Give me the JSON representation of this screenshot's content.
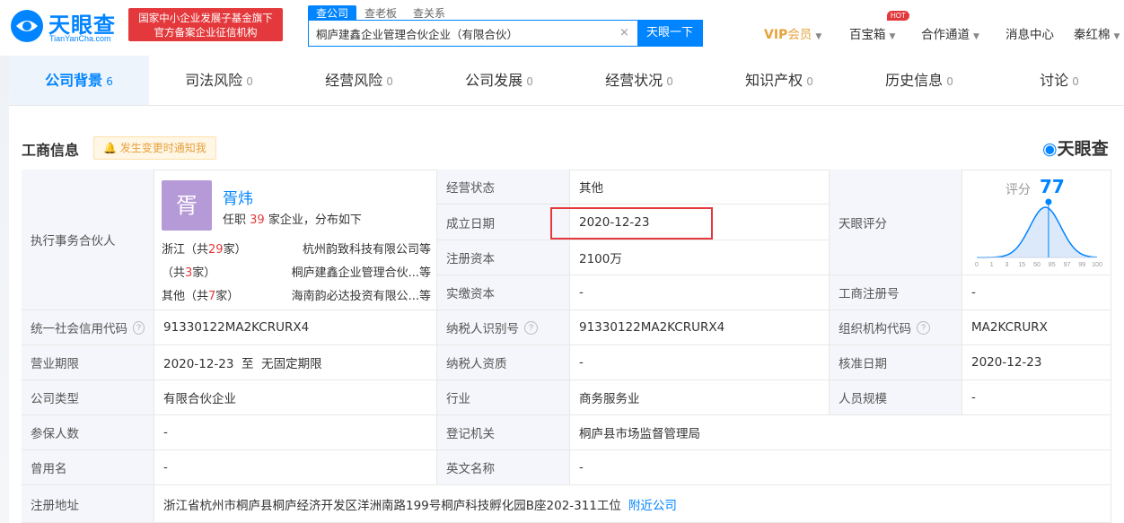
{
  "header": {
    "logo_text": "天眼查",
    "logo_sub": "TianYanCha.com",
    "gov_badge_line1": "国家中小企业发展子基金旗下",
    "gov_badge_line2": "官方备案企业征信机构",
    "search_tabs": [
      "查公司",
      "查老板",
      "查关系"
    ],
    "search_value": "桐庐建鑫企业管理合伙企业（有限合伙）",
    "search_button": "天眼一下",
    "vip": "VIP",
    "vip_label": "会员",
    "treasure": "百宝箱",
    "hot_badge": "HOT",
    "cooperation": "合作通道",
    "messages": "消息中心",
    "user": "秦红棉",
    "brand_color": "#0084ff",
    "accent_red": "#e4393c"
  },
  "tabs": [
    {
      "label": "公司背景",
      "count": "6"
    },
    {
      "label": "司法风险",
      "count": "0"
    },
    {
      "label": "经营风险",
      "count": "0"
    },
    {
      "label": "公司发展",
      "count": "0"
    },
    {
      "label": "经营状况",
      "count": "0"
    },
    {
      "label": "知识产权",
      "count": "0"
    },
    {
      "label": "历史信息",
      "count": "0"
    },
    {
      "label": "讨论",
      "count": "0"
    }
  ],
  "section": {
    "title": "工商信息",
    "notify": "发生变更时通知我",
    "brand": "天眼查"
  },
  "partner": {
    "label": "执行事务合伙人",
    "avatar": "胥",
    "name": "胥炜",
    "line_prefix": "任职",
    "line_count": "39",
    "line_suffix": "家企业，分布如下",
    "rows": [
      {
        "region_pre": "浙江（共",
        "num": "29",
        "region_post": "家）",
        "company": "杭州韵致科技有限公司等"
      },
      {
        "region_pre": "（共",
        "num": "3",
        "region_post": "家）",
        "company": "桐庐建鑫企业管理合伙...等"
      },
      {
        "region_pre": "其他（共",
        "num": "7",
        "region_post": "家）",
        "company": "海南韵必达投资有限公...等"
      }
    ]
  },
  "fields": {
    "status_label": "经营状态",
    "status": "其他",
    "founded_label": "成立日期",
    "founded": "2020-12-23",
    "reg_capital_label": "注册资本",
    "reg_capital": "2100万",
    "paid_capital_label": "实缴资本",
    "paid_capital": "-",
    "score_label": "天眼评分",
    "score_word": "评分",
    "score": "77",
    "score_ticks": [
      "0",
      "1",
      "3",
      "15",
      "50",
      "85",
      "97",
      "99",
      "100"
    ],
    "reg_no_label": "工商注册号",
    "reg_no": "-",
    "credit_code_label": "统一社会信用代码",
    "credit_code": "91330122MA2KCRURX4",
    "taxpayer_id_label": "纳税人识别号",
    "taxpayer_id": "91330122MA2KCRURX4",
    "org_code_label": "组织机构代码",
    "org_code": "MA2KCRURX",
    "term_label": "营业期限",
    "term": "2020-12-23  至  无固定期限",
    "taxpayer_qual_label": "纳税人资质",
    "taxpayer_qual": "-",
    "approval_label": "核准日期",
    "approval": "2020-12-23",
    "type_label": "公司类型",
    "type": "有限合伙企业",
    "industry_label": "行业",
    "industry": "商务服务业",
    "staff_label": "人员规模",
    "staff": "-",
    "insured_label": "参保人数",
    "insured": "-",
    "authority_label": "登记机关",
    "authority": "桐庐县市场监督管理局",
    "former_label": "曾用名",
    "former": "-",
    "english_label": "英文名称",
    "english": "-",
    "address_label": "注册地址",
    "address": "浙江省杭州市桐庐县桐庐经济开发区洋洲南路199号桐庐科技孵化园B座202-311工位",
    "nearby": "附近公司"
  }
}
